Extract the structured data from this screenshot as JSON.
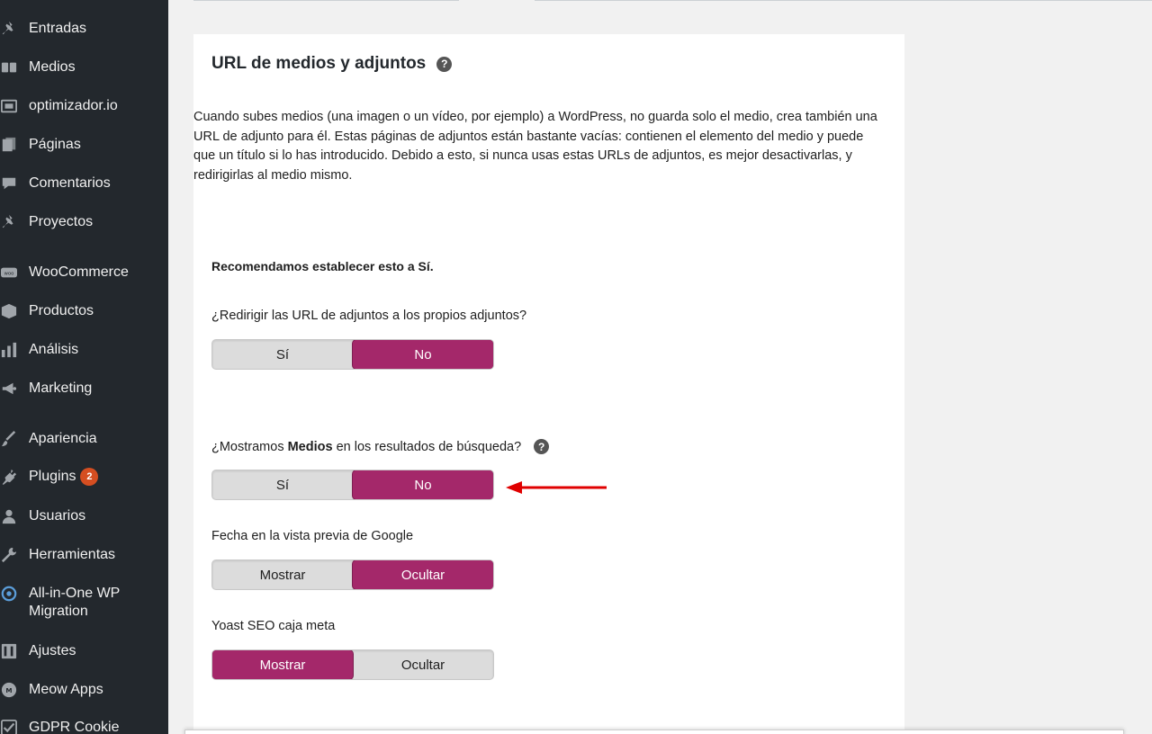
{
  "sidebar": {
    "items": [
      {
        "label": "Entradas",
        "icon": "pin-icon"
      },
      {
        "label": "Medios",
        "icon": "media-icon"
      },
      {
        "label": "optimizador.io",
        "icon": "optimizer-icon"
      },
      {
        "label": "Páginas",
        "icon": "pages-icon"
      },
      {
        "label": "Comentarios",
        "icon": "comments-icon"
      },
      {
        "label": "Proyectos",
        "icon": "pin-icon"
      },
      {
        "label": "WooCommerce",
        "icon": "woo-icon"
      },
      {
        "label": "Productos",
        "icon": "products-icon"
      },
      {
        "label": "Análisis",
        "icon": "analytics-icon"
      },
      {
        "label": "Marketing",
        "icon": "megaphone-icon"
      },
      {
        "label": "Apariencia",
        "icon": "brush-icon"
      },
      {
        "label": "Plugins",
        "icon": "plugins-icon",
        "badge": "2"
      },
      {
        "label": "Usuarios",
        "icon": "users-icon"
      },
      {
        "label": "Herramientas",
        "icon": "wrench-icon"
      },
      {
        "label": "All-in-One WP Migration",
        "icon": "migration-icon"
      },
      {
        "label": "Ajustes",
        "icon": "settings-icon"
      },
      {
        "label": "Meow Apps",
        "icon": "meow-icon"
      },
      {
        "label": "GDPR Cookie",
        "icon": "check-icon"
      }
    ]
  },
  "card": {
    "title": "URL de medios y adjuntos",
    "description": "Cuando subes medios (una imagen o un vídeo, por ejemplo) a WordPress, no guarda solo el medio, crea también una URL de adjunto para él. Estas páginas de adjuntos están bastante vacías: contienen el elemento del medio y puede que un título si lo has introducido. Debido a esto, si nunca usas estas URLs de adjuntos, es mejor desactivarlas, y redirigirlas al medio mismo.",
    "recommend": "Recomendamos establecer esto a Sí.",
    "redirect": {
      "label": "¿Redirigir las URL de adjuntos a los propios adjuntos?",
      "options": [
        "Sí",
        "No"
      ],
      "selected": "No"
    },
    "show_media": {
      "label_prefix": "¿Mostramos ",
      "label_bold": "Medios",
      "label_suffix": " en los resultados de búsqueda?",
      "options": [
        "Sí",
        "No"
      ],
      "selected": "No"
    },
    "date_preview": {
      "label": "Fecha en la vista previa de Google",
      "options": [
        "Mostrar",
        "Ocultar"
      ],
      "selected": "Ocultar"
    },
    "meta_box": {
      "label": "Yoast SEO caja meta",
      "options": [
        "Mostrar",
        "Ocultar"
      ],
      "selected": "Mostrar"
    }
  },
  "colors": {
    "sidebar_bg": "#23282d",
    "toggle_active": "#a4286a",
    "arrow": "#e00000",
    "badge": "#d54e21"
  }
}
